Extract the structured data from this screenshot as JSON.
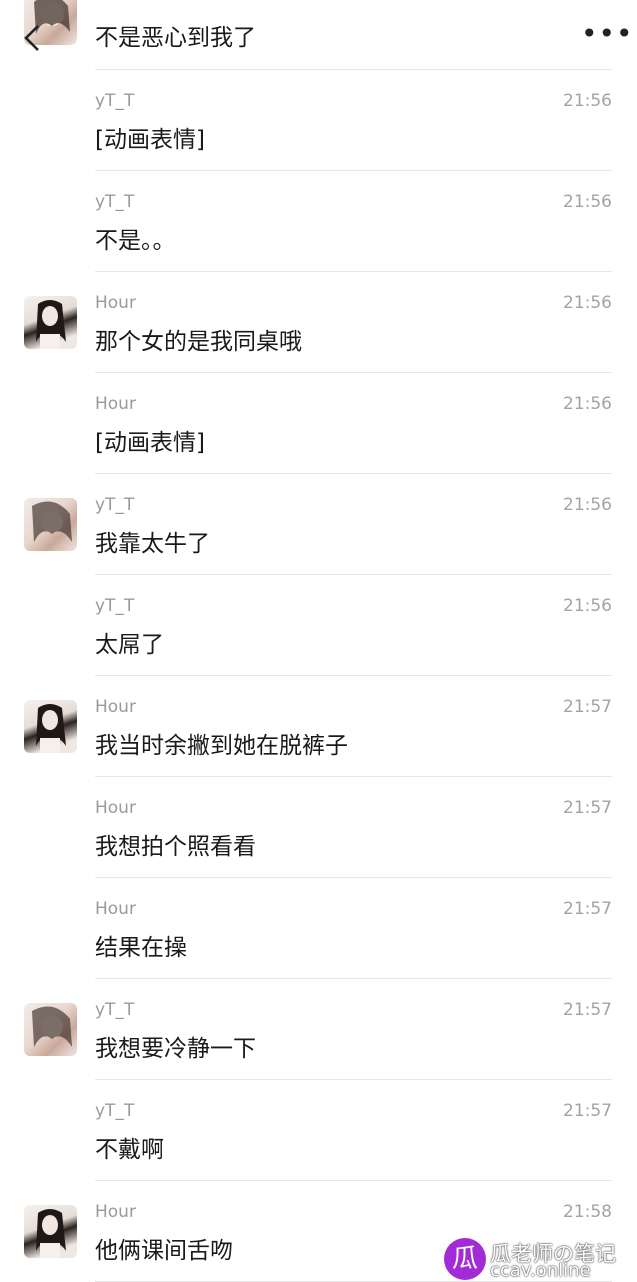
{
  "header": {
    "more_label": "•••",
    "top_message": "不是恶心到我了"
  },
  "messages": [
    {
      "sender": "yT_T",
      "time": "21:56",
      "text": "[动画表情]",
      "avatar": false
    },
    {
      "sender": "yT_T",
      "time": "21:56",
      "text": "不是。。",
      "avatar": false
    },
    {
      "sender": "Hour",
      "time": "21:56",
      "text": "那个女的是我同桌哦",
      "avatar": true
    },
    {
      "sender": "Hour",
      "time": "21:56",
      "text": "[动画表情]",
      "avatar": false
    },
    {
      "sender": "yT_T",
      "time": "21:56",
      "text": "我靠太牛了",
      "avatar": true
    },
    {
      "sender": "yT_T",
      "time": "21:56",
      "text": "太屌了",
      "avatar": false
    },
    {
      "sender": "Hour",
      "time": "21:57",
      "text": "我当时余撇到她在脱裤子",
      "avatar": true
    },
    {
      "sender": "Hour",
      "time": "21:57",
      "text": "我想拍个照看看",
      "avatar": false
    },
    {
      "sender": "Hour",
      "time": "21:57",
      "text": "结果在操",
      "avatar": false
    },
    {
      "sender": "yT_T",
      "time": "21:57",
      "text": "我想要冷静一下",
      "avatar": true
    },
    {
      "sender": "yT_T",
      "time": "21:57",
      "text": "不戴啊",
      "avatar": false
    },
    {
      "sender": "Hour",
      "time": "21:58",
      "text": "他俩课间舌吻",
      "avatar": true
    }
  ],
  "watermark": {
    "badge": "瓜",
    "title": "瓜老师の笔记",
    "subtitle": "ccav.online"
  },
  "icons": {
    "back": "chevron-left-icon",
    "more": "more-dots-icon"
  }
}
